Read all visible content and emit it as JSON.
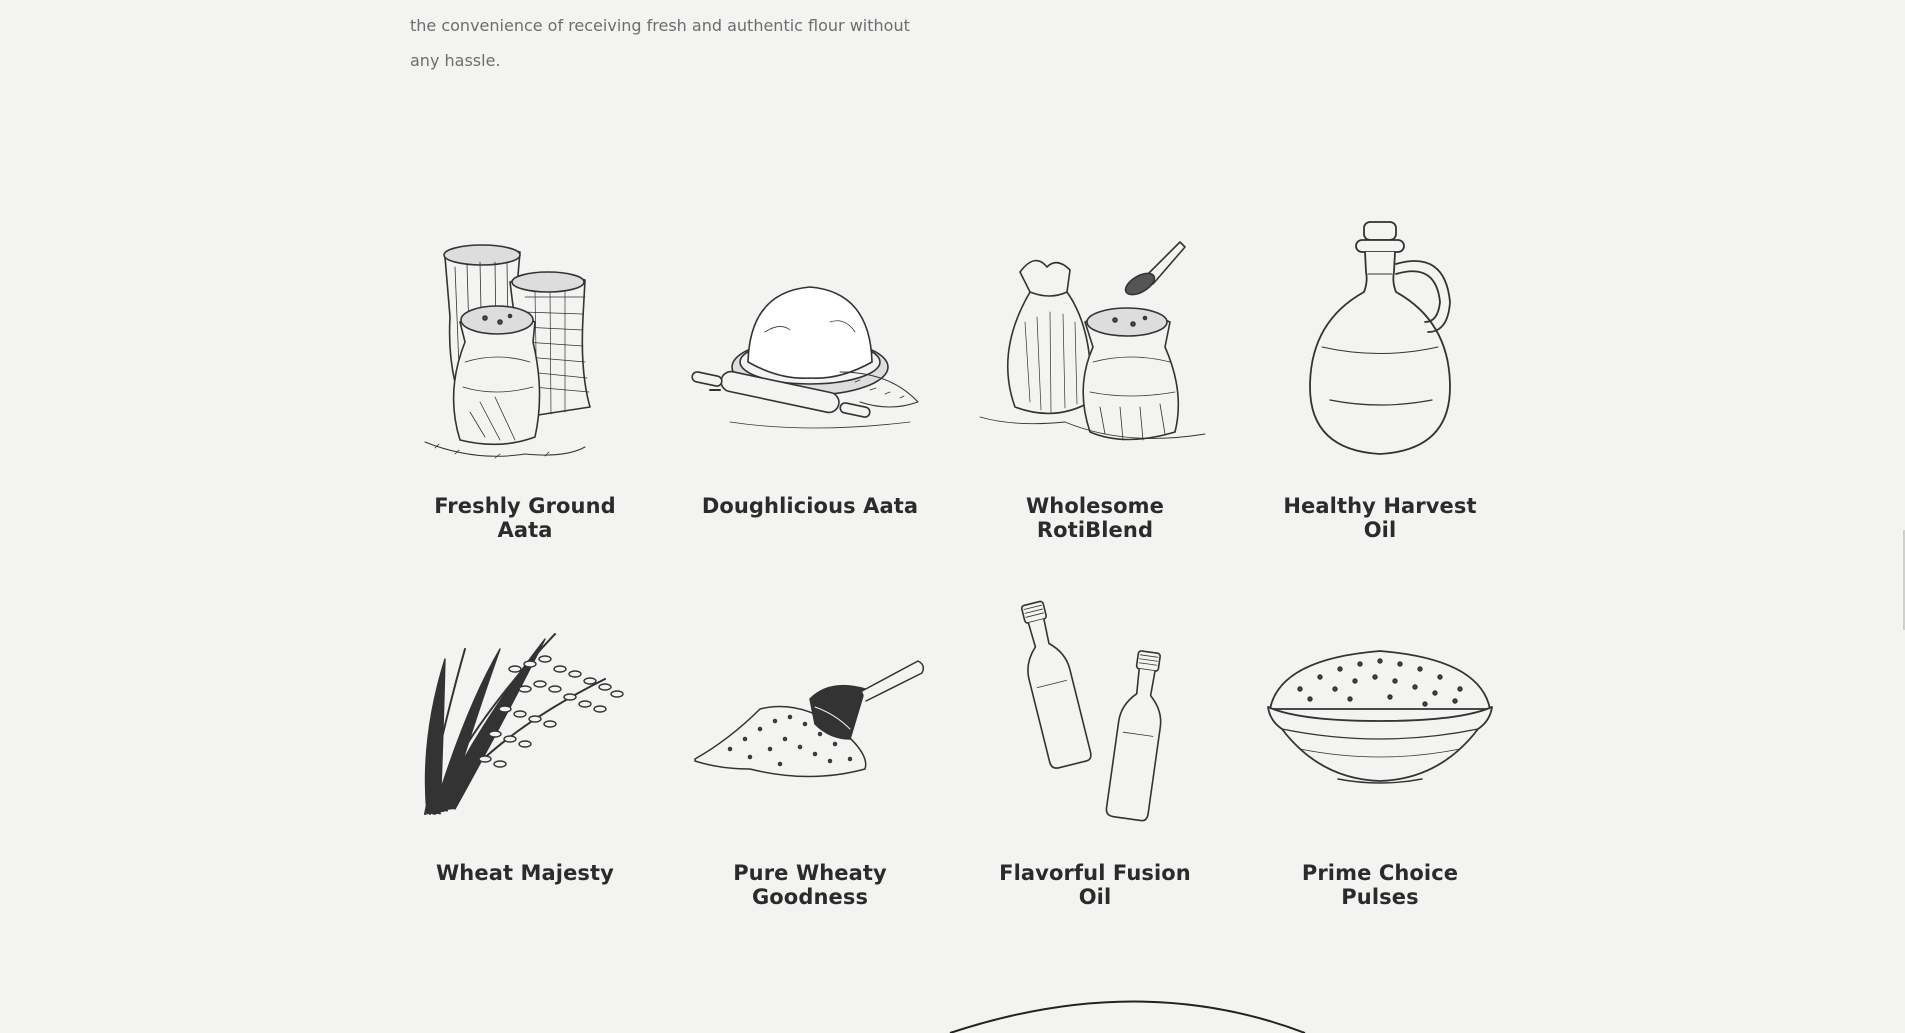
{
  "intro": {
    "text": "the convenience of receiving fresh and authentic flour without any hassle."
  },
  "products": [
    {
      "name": "Freshly Ground Aata",
      "icon": "flour-sacks-icon"
    },
    {
      "name": "Doughlicious Aata",
      "icon": "dough-rolling-pin-icon"
    },
    {
      "name": "Wholesome RotiBlend",
      "icon": "grain-sacks-scoop-icon"
    },
    {
      "name": "Healthy Harvest Oil",
      "icon": "oil-jug-icon"
    },
    {
      "name": "Wheat Majesty",
      "icon": "wheat-stalks-icon"
    },
    {
      "name": "Pure Wheaty Goodness",
      "icon": "grain-scoop-icon"
    },
    {
      "name": "Flavorful Fusion Oil",
      "icon": "oil-bottles-icon"
    },
    {
      "name": "Prime Choice Pulses",
      "icon": "pulses-bowl-icon"
    }
  ],
  "colors": {
    "background": "#f3f3f1",
    "heading": "#2b2b2b",
    "body_text": "#6d6d6d",
    "line_art": "#333333"
  }
}
